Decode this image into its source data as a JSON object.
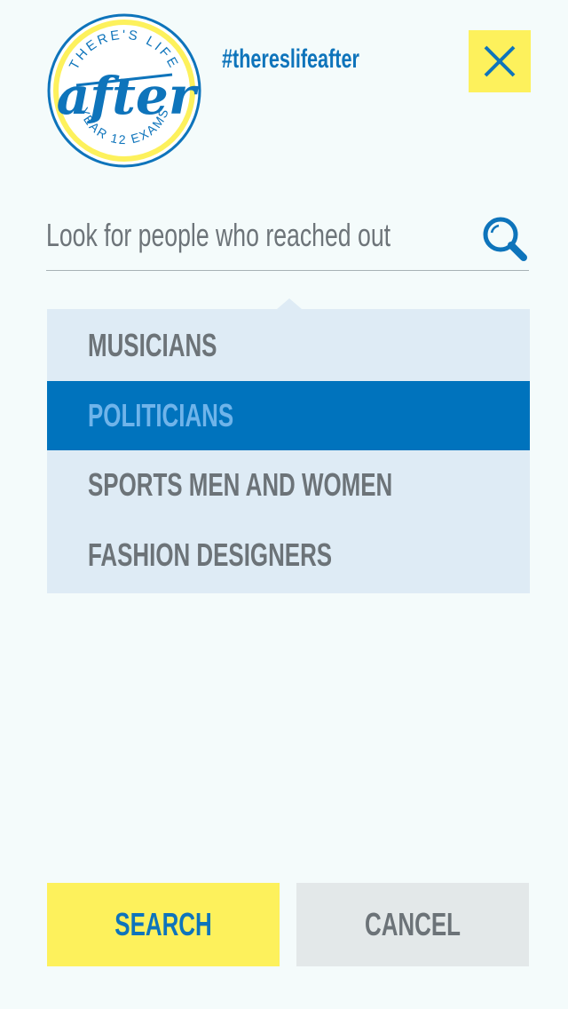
{
  "logo": {
    "top_text": "THERE'S LIFE",
    "main_text": "after",
    "bottom_text": "YEAR 12 EXAMS"
  },
  "hashtag": "#thereslifeafter",
  "close_button": {
    "label": "X"
  },
  "search": {
    "placeholder": "Look for people who reached out",
    "value": ""
  },
  "dropdown": {
    "items": [
      {
        "label": "MUSICIANS",
        "selected": false
      },
      {
        "label": "POLITICIANS",
        "selected": true
      },
      {
        "label": "SPORTS MEN AND WOMEN",
        "selected": false
      },
      {
        "label": "FASHION DESIGNERS",
        "selected": false
      }
    ]
  },
  "buttons": {
    "search_label": "SEARCH",
    "cancel_label": "CANCEL"
  },
  "colors": {
    "background": "#f4fbfb",
    "brand_blue": "#0073bd",
    "accent_yellow": "#fdf15c",
    "dropdown_bg": "#deebf5",
    "text_gray": "#6c7378",
    "selected_text": "#6fb4ea",
    "cancel_bg": "#e3e8e9"
  }
}
